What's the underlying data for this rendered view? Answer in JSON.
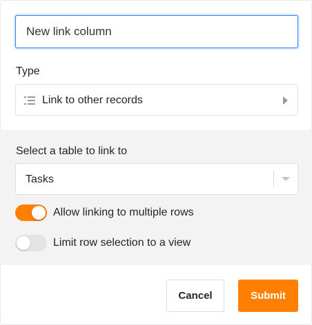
{
  "column_name": {
    "value": "New link column",
    "placeholder": ""
  },
  "type": {
    "label": "Type",
    "selected": "Link to other records",
    "icon": "list-icon"
  },
  "link_table": {
    "label": "Select a table to link to",
    "selected": "Tasks"
  },
  "toggles": {
    "allow_multiple": {
      "label": "Allow linking to multiple rows",
      "on": true
    },
    "limit_view": {
      "label": "Limit row selection to a view",
      "on": false
    }
  },
  "buttons": {
    "cancel": "Cancel",
    "submit": "Submit"
  },
  "colors": {
    "accent": "#ff8000",
    "focus": "#2d7ff9",
    "section_bg": "#f3f3f3"
  }
}
